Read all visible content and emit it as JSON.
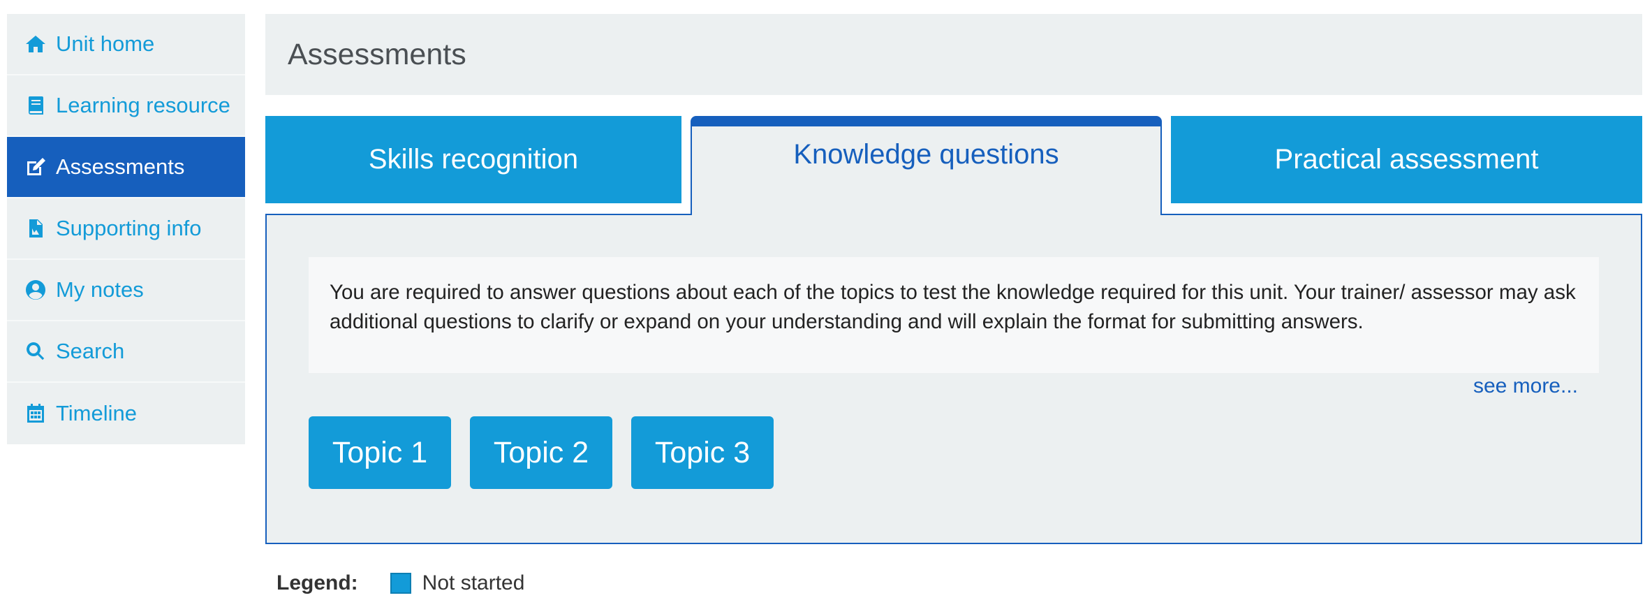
{
  "sidebar": {
    "items": [
      {
        "label": "Unit home",
        "icon": "home-icon"
      },
      {
        "label": "Learning resource",
        "icon": "book-icon"
      },
      {
        "label": "Assessments",
        "icon": "edit-icon"
      },
      {
        "label": "Supporting info",
        "icon": "document-icon"
      },
      {
        "label": "My notes",
        "icon": "user-circle-icon"
      },
      {
        "label": "Search",
        "icon": "search-icon"
      },
      {
        "label": "Timeline",
        "icon": "calendar-icon"
      }
    ],
    "active": "Assessments"
  },
  "header": {
    "title": "Assessments"
  },
  "tabs": [
    {
      "label": "Skills recognition"
    },
    {
      "label": "Knowledge questions"
    },
    {
      "label": "Practical assessment"
    }
  ],
  "panel": {
    "intro": "You are required to answer questions about each of the topics to test the knowledge required for this unit. Your trainer/ assessor may ask additional questions to clarify or expand on your understanding and will explain the format for submitting answers.",
    "see_more": "see more...",
    "topics": [
      {
        "label": "Topic 1"
      },
      {
        "label": "Topic 2"
      },
      {
        "label": "Topic 3"
      }
    ]
  },
  "legend": {
    "label": "Legend:",
    "items": [
      {
        "label": "Not started",
        "color": "#139bd8"
      }
    ]
  },
  "colors": {
    "primary": "#139bd8",
    "active": "#165fbd",
    "panel_bg": "#ecf0f1"
  }
}
